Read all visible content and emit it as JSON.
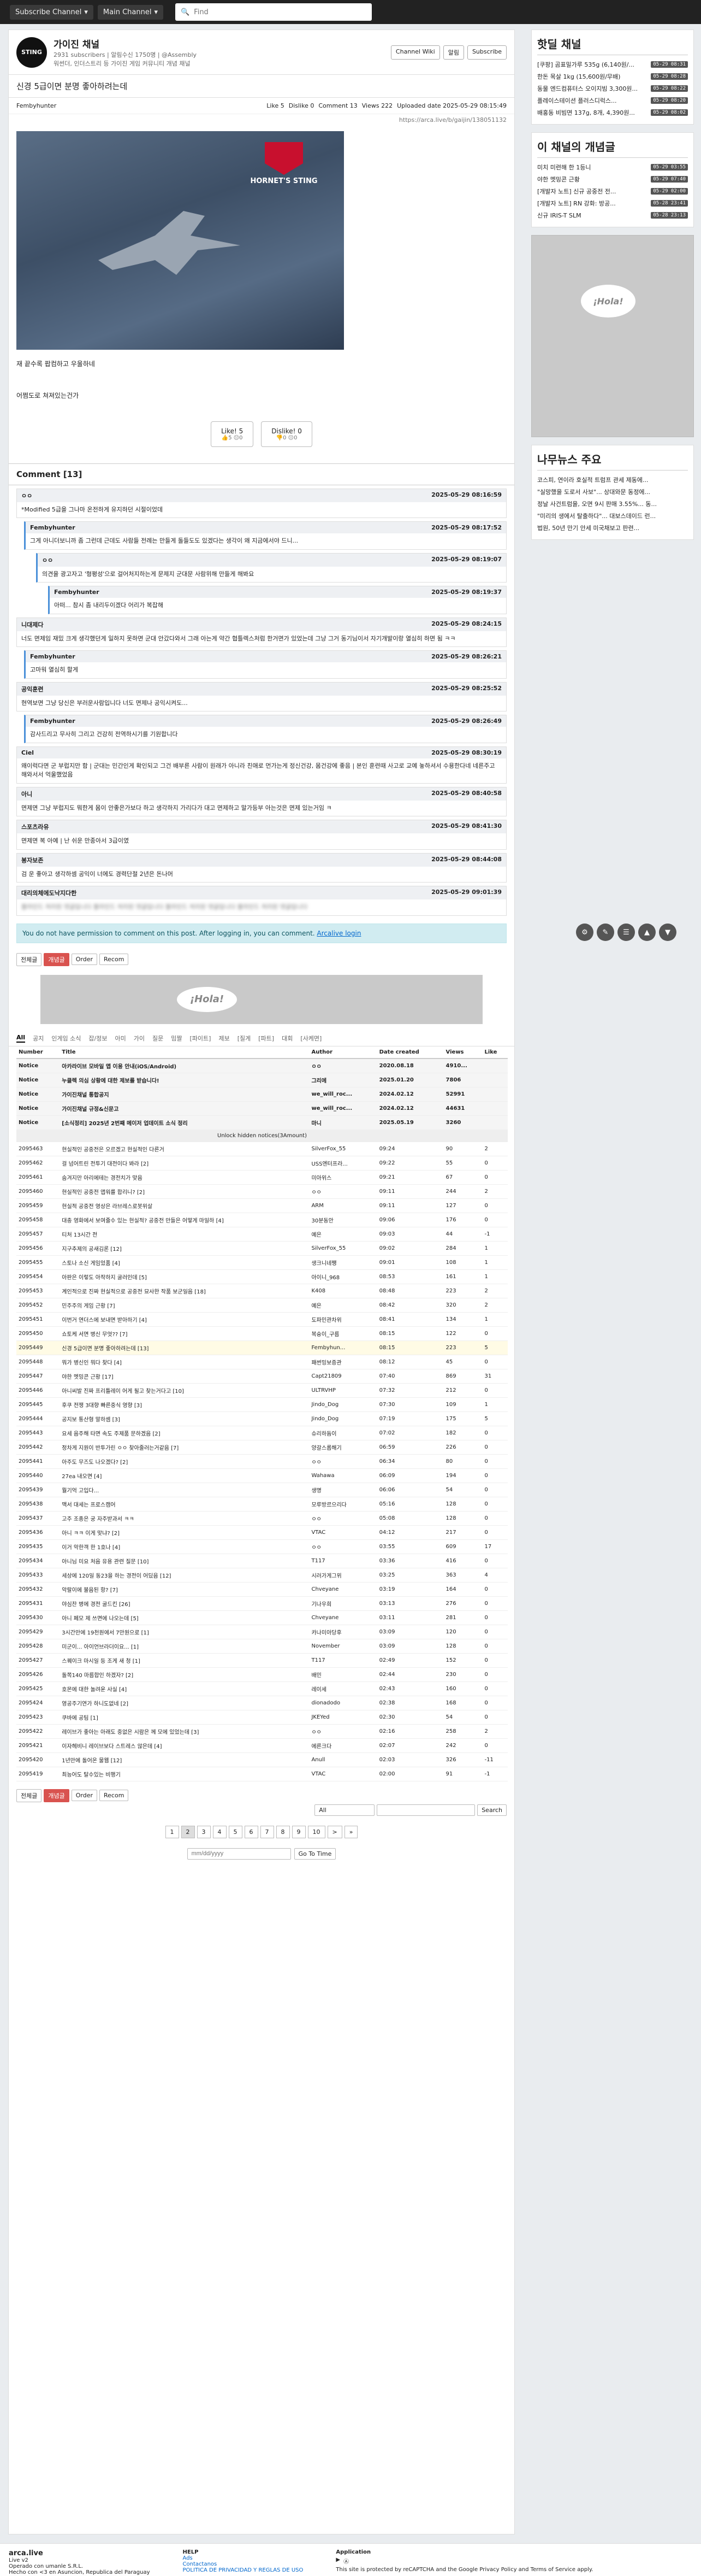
{
  "topbar": {
    "subscribe": "Subscribe Channel",
    "main": "Main Channel",
    "search_placeholder": "Find"
  },
  "channel": {
    "logo": "STING",
    "name": "가이진 채널",
    "subs": "2931 subscribers | 알림수신 1750명 | @Assembly",
    "desc": "워썬더, 인더스트리 등 가이진 게임 커뮤니티 개념 채널",
    "btn_wiki": "Channel Wiki",
    "btn_notify": "알림",
    "btn_subscribe": "Subscribe"
  },
  "post": {
    "title": "신경 5급이면 분명 좋아하려는데",
    "author": "Fembyhunter",
    "like": "Like 5",
    "dislike": "Dislike 0",
    "comments": "Comment 13",
    "views": "Views 222",
    "uploaded": "Uploaded date 2025-05-29 08:15:49",
    "url": "https://arca.live/b/gaijin/138051132",
    "image_title": "HORNET'S STING",
    "text1": "재 끝수록 팝컴하고 우울하네",
    "text2": "어쩜도로 쳐져있는건가",
    "like_btn": "Like! 5",
    "like_sub": "👍5 😐0",
    "dislike_btn": "Dislike! 0",
    "dislike_sub": "👎0 😐0"
  },
  "comment_head": "Comment [13]",
  "comments": [
    {
      "author": "ㅇㅇ",
      "date": "2025-05-29 08:16:59",
      "text": "*Modified 5급을 그나마 온전하게 유지하던 시절이었데"
    },
    {
      "author": "Fembyhunter",
      "date": "2025-05-29 08:17:52",
      "text": "그게 아니더보니까 좀 그런데 근데도 사람들 전례는 만들게 돌들도도 있겠다는 생각이 왜 지금에서야 드니..."
    },
    {
      "author": "ㅇㅇ",
      "date": "2025-05-29 08:19:07",
      "text": "의견을 광고자고 '형평성'으로 걸어처지하는게 문제지 군대문 사람위해 만들게 해봐요"
    },
    {
      "author": "Fembyhunter",
      "date": "2025-05-29 08:19:37",
      "text": "아떠... 참시 좀 내리두이겠다 어리가 복잡해"
    },
    {
      "author": "니대제다",
      "date": "2025-05-29 08:24:15",
      "text": "너도 면제임 재밌 크게 생각했던게 일하지 못하면 군대 안갔다와서 그래 아는게 약간 협틀렉스처럼 한거면가 있었는데 그냥 그거 동기님이서 자기개발이랑 열심히 하면 됨 ㅋㅋ"
    },
    {
      "author": "Fembyhunter",
      "date": "2025-05-29 08:26:21",
      "text": "고마워 열심히 할게"
    },
    {
      "author": "공익훈련",
      "date": "2025-05-29 08:25:52",
      "text": "현역보면 그냥 당신은 부러운사람입니다 너도 면제나 공익시켜도..."
    },
    {
      "author": "Fembyhunter",
      "date": "2025-05-29 08:26:49",
      "text": "감사드리고 무사히 그리고 건강히 전역하시기를 기원합니다"
    },
    {
      "author": "Ciel",
      "date": "2025-05-29 08:30:19",
      "text": "왜이럭다면 군 부럽지만 함 | 군대는 민간인게 확인되고 그건 배부른 사람이 원래가 아니라 친애로 먼가는게 정신건강, 몸건강에 좋음 | 본인 훈련때 사고로 교예 놓하셔서 수용한다네 네른주고 해와서서 억울했었음"
    },
    {
      "author": "아니",
      "date": "2025-05-29 08:40:58",
      "text": "면제면 그냥 부럽지도 뭐한게 몸이 안좋은가보다 하고 생각하지 가리다가 대고 면제하고 말가등부 아는것은 면제 있는거임 ㅋ"
    },
    {
      "author": "스포츠라유",
      "date": "2025-05-29 08:41:30",
      "text": "면제면 복 아예 | 난 쉬운 만종아서 3급이였"
    },
    {
      "author": "봉자보존",
      "date": "2025-05-29 08:44:08",
      "text": "검 운 좋아고 생각하셈 공익이 너에도 경력단절 2년은 돈나머"
    },
    {
      "author": "대리의체에도낙지다한",
      "date": "2025-05-29 09:01:39",
      "text": "블라인드 처리된 댓글입니다 블라인드 처리된 댓글입니다 블라인드 처리된 댓글입니다 블라인드 처리된 댓글입니다"
    }
  ],
  "login_note": {
    "text": "You do not have permission to comment on this post. After logging in, you can comment.",
    "link": "Arcalive login"
  },
  "toolbar": {
    "all": "전체글",
    "best": "개념글",
    "order": "Order",
    "recom": "Recom"
  },
  "ad": {
    "hola": "¡Hola!"
  },
  "categories": [
    "All",
    "공지",
    "인게임 소식",
    "잡/정보",
    "아미",
    "가이",
    "질문",
    "밈짤",
    "[파이트]",
    "제보",
    "[질게",
    "[파트]",
    "대회",
    "[사케면]"
  ],
  "table": {
    "headers": [
      "Number",
      "Title",
      "Author",
      "Date created",
      "Views",
      "Like"
    ],
    "notices": [
      [
        "Notice",
        "아카라이브 모바일 앱 이용 안내(iOS/Android)",
        "ㅇㅇ",
        "2020.08.18",
        "4910...",
        ""
      ],
      [
        "Notice",
        "누클렉 의심 상황에 대한 제보를 받습니다!",
        "그리에",
        "2025.01.20",
        "7806",
        ""
      ],
      [
        "Notice",
        "가이진채널 통합공지",
        "we_will_roc...",
        "2024.02.12",
        "52991",
        ""
      ],
      [
        "Notice",
        "가이진채널 규정&신문고",
        "we_will_roc...",
        "2024.02.12",
        "44631",
        ""
      ],
      [
        "Notice",
        "[소식정리] 2025년 2번째 메이저 업데이트 소식 정리",
        "마니",
        "2025.05.19",
        "3260",
        ""
      ]
    ],
    "unlock": "Unlock hidden notices(3Amount)",
    "rows": [
      [
        "2095463",
        "현실적인 공중전은 오르겠고 현실적인 다른거",
        "SilverFox_55",
        "09:24",
        "90",
        "2"
      ],
      [
        "2095462",
        "걸 넘어트린 전투기 대전이다 봐라 [2]",
        "USS엔터프라...",
        "09:22",
        "55",
        "0"
      ],
      [
        "2095461",
        "숨겨지만 아리에테는 경전치가 맞음",
        "미아위스",
        "09:21",
        "67",
        "0"
      ],
      [
        "2095460",
        "현실적인 공중전 앱워를 합리니? [2]",
        "ㅇㅇ",
        "09:11",
        "244",
        "2"
      ],
      [
        "2095459",
        "현실적 공중전 영상은 라브레스로봇위살",
        "ARM",
        "09:11",
        "127",
        "0"
      ],
      [
        "2095458",
        "대충 영화에서 보여줄수 있는 현실적? 공중전 만들은 어떻게 마일하 [4]",
        "30분동안",
        "09:06",
        "176",
        "0"
      ],
      [
        "2095457",
        "티처 13시간 전",
        "예은",
        "09:03",
        "44",
        "-1"
      ],
      [
        "2095456",
        "지구추제의 공새김론 [12]",
        "SilverFox_55",
        "09:02",
        "284",
        "1"
      ],
      [
        "2095455",
        "스토나 소신 게임었품 [4]",
        "생크니네쨍",
        "09:01",
        "108",
        "1"
      ],
      [
        "2095454",
        "아판은 이렇도 아작하지 굴러인데 [5]",
        "아이니_968",
        "08:53",
        "161",
        "1"
      ],
      [
        "2095453",
        "계인적으로 진짜 현실적으로 공중전 묘사한 작품 보군일음 [18]",
        "K408",
        "08:48",
        "223",
        "2"
      ],
      [
        "2095452",
        "민주주의 게임 근황 [7]",
        "예은",
        "08:42",
        "320",
        "2"
      ],
      [
        "2095451",
        "이번거 연더스에 보내면 받아하기 [4]",
        "도파민관차위",
        "08:41",
        "134",
        "1"
      ],
      [
        "2095450",
        "쇼토케 서면 병신 무엇?? [7]",
        "복슝이_구름",
        "08:15",
        "122",
        "0"
      ],
      [
        "2095449",
        "신경 5급이면 분명 좋아하려는데 [13]",
        "Fembyhun...",
        "08:15",
        "223",
        "5"
      ],
      [
        "2095448",
        "뭐가 병신인 뭐다 찾다 [4]",
        "패썬밍보증관",
        "08:12",
        "45",
        "0"
      ],
      [
        "2095447",
        "야한 멧밍콘 근황 [17]",
        "Capt21809",
        "07:40",
        "869",
        "31"
      ],
      [
        "2095446",
        "아니씨발 진짜 프리틀레이 어게 될고 찾는거다고 [10]",
        "ULTRVHP",
        "07:32",
        "212",
        "0"
      ],
      [
        "2095445",
        "후쿠 전쟁 3대향 빠른중식 영향 [3]",
        "Jindo_Dog",
        "07:30",
        "109",
        "1"
      ],
      [
        "2095444",
        "공지보 통산형 말하셈 [3]",
        "Jindo_Dog",
        "07:19",
        "175",
        "5"
      ],
      [
        "2095443",
        "요세 음주해 타면 속도 주제품 문하겠음 [2]",
        "슈리하듐이",
        "07:02",
        "182",
        "0"
      ],
      [
        "2095442",
        "정차게 지원이 반투가린 ㅇㅇ 찾아줄러는거같음 [7]",
        "양갈스롭해기",
        "06:59",
        "226",
        "0"
      ],
      [
        "2095441",
        "아주도 무즈도 나오겠다? [2]",
        "ㅇㅇ",
        "06:34",
        "80",
        "0"
      ],
      [
        "2095440",
        "27ea 내오면 [4]",
        "Wahawa",
        "06:09",
        "194",
        "0"
      ],
      [
        "2095439",
        "뭘기억 고입다...",
        "생명",
        "06:06",
        "54",
        "0"
      ],
      [
        "2095438",
        "맥서 대세는 프로스캠어",
        "모루방르으리다",
        "05:16",
        "128",
        "0"
      ],
      [
        "2095437",
        "고주 조종은 궁 자주받과서 ㅋㅋ",
        "ㅇㅇ",
        "05:08",
        "128",
        "0"
      ],
      [
        "2095436",
        "아니 ㅋㅋ 이게 맞냐? [2]",
        "VTAC",
        "04:12",
        "217",
        "0"
      ],
      [
        "2095435",
        "이거 악한객 한 1호나 [4]",
        "ㅇㅇ",
        "03:55",
        "609",
        "17"
      ],
      [
        "2095434",
        "아니님 미요 처음 유용 관련 질문 [10]",
        "T117",
        "03:36",
        "416",
        "0"
      ],
      [
        "2095433",
        "세상에 120일 동23을 하는 경전이 어딨음 [12]",
        "시러가게그위",
        "03:25",
        "363",
        "4"
      ],
      [
        "2095432",
        "악랄이에 불음된 항? [7]",
        "Chveyane",
        "03:19",
        "164",
        "0"
      ],
      [
        "2095431",
        "야심찬 병에 경전 굴드킨 [26]",
        "기나우희",
        "03:13",
        "276",
        "0"
      ],
      [
        "2095430",
        "아니 페모 제 쓰면에 나오는데 [5]",
        "Chveyane",
        "03:11",
        "281",
        "0"
      ],
      [
        "2095429",
        "3시간만에 19천원에서 7만원으로 [1]",
        "카나미아당후",
        "03:09",
        "120",
        "0"
      ],
      [
        "2095428",
        "미군이... 아이언브라더이요... [1]",
        "November",
        "03:09",
        "128",
        "0"
      ],
      [
        "2095427",
        "스퀘이크 마시일 등 조게 새 청 [1]",
        "T117",
        "02:49",
        "152",
        "0"
      ],
      [
        "2095426",
        "돌쪽140 마름합인 하겠자? [2]",
        "배민",
        "02:44",
        "230",
        "0"
      ],
      [
        "2095425",
        "호몬에 대한 놀려운 사실 [4]",
        "레이세",
        "02:43",
        "160",
        "0"
      ],
      [
        "2095424",
        "영공주기연가 하니도없네 [2]",
        "dionadodo",
        "02:38",
        "168",
        "0"
      ],
      [
        "2095423",
        "쿠바에 공팀 [1]",
        "JKEYed",
        "02:30",
        "54",
        "0"
      ],
      [
        "2095422",
        "레이브가 좋아는 아래도 중없은 시람은 께 모에 있었는데 [3]",
        "ㅇㅇ",
        "02:16",
        "258",
        "2"
      ],
      [
        "2095421",
        "이자헤비니 레이브보다 스트레스 않은데 [4]",
        "에른크다",
        "02:07",
        "242",
        "0"
      ],
      [
        "2095420",
        "1년만에 돌어온 물웹 [12]",
        "Anull",
        "02:03",
        "326",
        "-11"
      ],
      [
        "2095419",
        "최능어도 탈수있는 비행기",
        "VTAC",
        "02:00",
        "91",
        "-1"
      ]
    ]
  },
  "pager": [
    "1",
    "2",
    "3",
    "4",
    "5",
    "6",
    "7",
    "8",
    "9",
    "10",
    ">",
    "»"
  ],
  "search": {
    "scope": "All",
    "btn": "Search",
    "date_placeholder": "mm/dd/yyyy",
    "goto": "Go To Time"
  },
  "side": {
    "hot_title": "핫딜 채널",
    "hot": [
      {
        "t": "[쿠팡] 곰표밀가루 535g (6,140원/...",
        "d": "05-29 08:31"
      },
      {
        "t": "한돈 목살 1kg (15,600원/무배)",
        "d": "05-29 08:28"
      },
      {
        "t": "동물 엔드컴퓨터스 오이지빔 3,300원...",
        "d": "05-29 08:22"
      },
      {
        "t": "플레이스테이션 플러스디럭스...",
        "d": "05-29 08:20"
      },
      {
        "t": "배홍동 비빔면 137g, 8개, 4,390원...",
        "d": "05-29 08:02"
      }
    ],
    "concept_title": "이 채널의 개념글",
    "concept": [
      {
        "t": "미치 미련해 한 1등니",
        "d": "05-29 03:55"
      },
      {
        "t": "야한 멧밍콘 근황",
        "d": "05-29 07:40"
      },
      {
        "t": "[개발자 노트] 신규 공중전 전...",
        "d": "05-29 02:00"
      },
      {
        "t": "[개발자 노트] RN 강화: 방공...",
        "d": "05-28 23:41"
      },
      {
        "t": "신규 IRIS-T SLM",
        "d": "05-28 23:13"
      }
    ],
    "news_title": "나무뉴스 주요",
    "news": [
      "코스피, 연이라 호실적 트럼프 관세 제동에...",
      "\"실망했을 도로서 사보\"... 상대와문 동정에...",
      "정날 사건트럼을, 오면 9시 판매 3.55%... 동...",
      "\"미리의 생에서 탈출하다\"... 대보스데이드 런...",
      "법원, 50년 만기 안세 미국채보고 판련..."
    ]
  },
  "footer": {
    "brand": "arca.live",
    "version": "Live v2",
    "visitors": "Operado con umanle S.R.L.",
    "help": "HELP",
    "ads": "Ads",
    "contact": "Contactanos",
    "policy": "POLITICA DE PRIVACIDAD Y REGLAS DE USO",
    "app": "Application",
    "recaptcha": "This site is protected by reCAPTCHA and the Google Privacy Policy and Terms of Service apply.",
    "made": "Hecho con <3 en Asuncion, Republica del Paraguay"
  }
}
